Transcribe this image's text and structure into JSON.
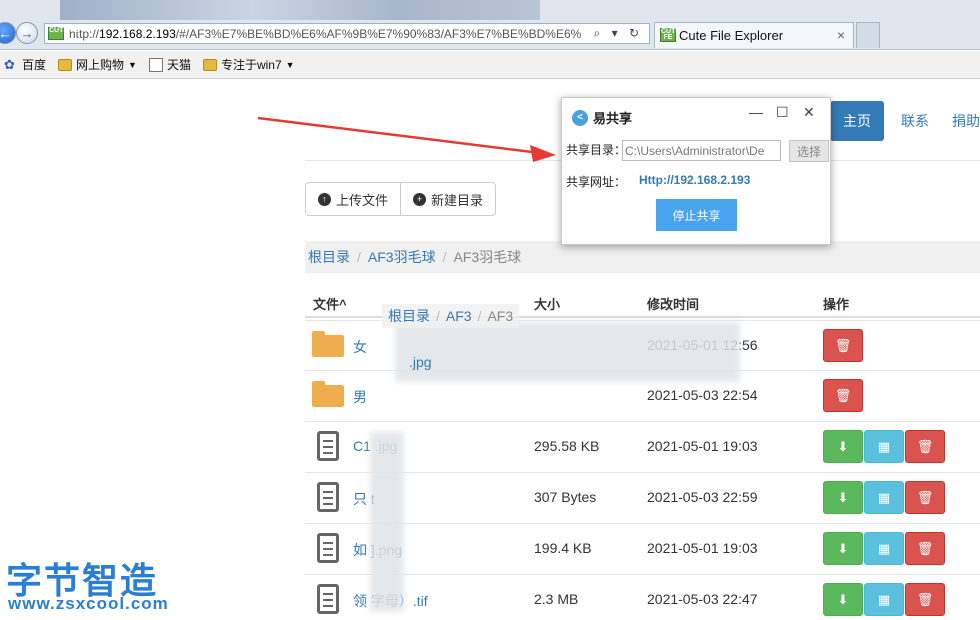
{
  "browser": {
    "address_url": "http://192.168.2.193/#/AF3%E7%BE%BD%E6%AF%9B%E7%90%83/AF3%E7%BE%BD%E6%",
    "address_prefix": "http://",
    "address_host": "192.168.2.193",
    "address_path": "/#/AF3%E7%BE%BD%E6%AF%9B%E7%90%83/AF3%E7%BE%BD%E6%",
    "address_tools": "⌕ ▾ ↻",
    "tab_title": "Cute File Explorer",
    "tab_close": "×",
    "favicon_text": "CUTE FE",
    "favorites": [
      {
        "label": "百度",
        "icon": "paw-icon"
      },
      {
        "label": "网上购物",
        "icon": "folder-icon",
        "dropdown": true
      },
      {
        "label": "天猫",
        "icon": "page-icon"
      },
      {
        "label": "专注于win7",
        "icon": "folder-icon",
        "dropdown": true
      }
    ],
    "caret": "▼"
  },
  "navbar": {
    "home": "主页",
    "contact": "联系",
    "donate": "捐助"
  },
  "toolbar": {
    "upload": "上传文件",
    "new_dir": "新建目录"
  },
  "breadcrumb": {
    "root": "根目录",
    "level1": "AF3羽毛球",
    "current": "AF3羽毛球",
    "sep": "/"
  },
  "ghost_breadcrumb": {
    "root": "根目录",
    "level1": "AF3",
    "level2": "AF3"
  },
  "table": {
    "headers": {
      "file": "文件^",
      "size": "大小",
      "mtime": "修改时间",
      "actions": "操作"
    },
    "rows": [
      {
        "type": "folder",
        "name": "女",
        "size": "",
        "mtime": "2021-05-01 12:56",
        "actions": [
          "delete"
        ]
      },
      {
        "type": "folder",
        "name": "男",
        "size": "",
        "mtime": "2021-05-03 22:54",
        "actions": [
          "delete"
        ]
      },
      {
        "type": "file",
        "name": "C1        .jpg",
        "size": "295.58 KB",
        "mtime": "2021-05-01 19:03",
        "actions": [
          "download",
          "qrcode",
          "delete"
        ]
      },
      {
        "type": "file",
        "name": "只        t",
        "size": "307 Bytes",
        "mtime": "2021-05-03 22:59",
        "actions": [
          "download",
          "qrcode",
          "delete"
        ]
      },
      {
        "type": "file",
        "name": "如        ].png",
        "size": "199.4 KB",
        "mtime": "2021-05-01 19:03",
        "actions": [
          "download",
          "qrcode",
          "delete"
        ]
      },
      {
        "type": "file",
        "name": "领        字母）.tif",
        "size": "2.3 MB",
        "mtime": "2021-05-03 22:47",
        "actions": [
          "download",
          "qrcode",
          "delete"
        ]
      }
    ],
    "floating_jpg": ".jpg"
  },
  "popup": {
    "title": "易共享",
    "minimize": "—",
    "maximize": "☐",
    "close": "✕",
    "dir_label": "共享目录：",
    "dir_value": "C:\\Users\\Administrator\\De",
    "choose": "选择",
    "url_label": "共享网址：",
    "url_value": "Http://192.168.2.193",
    "stop": "停止共享"
  },
  "watermark": {
    "cn": "字节智造",
    "en": "www.zsxcool.com"
  },
  "colors": {
    "primary": "#337ab7",
    "danger": "#d9534f",
    "success": "#5cb85c",
    "info": "#5bc0de",
    "folder": "#f0ad4e",
    "arrow": "#e53935"
  }
}
